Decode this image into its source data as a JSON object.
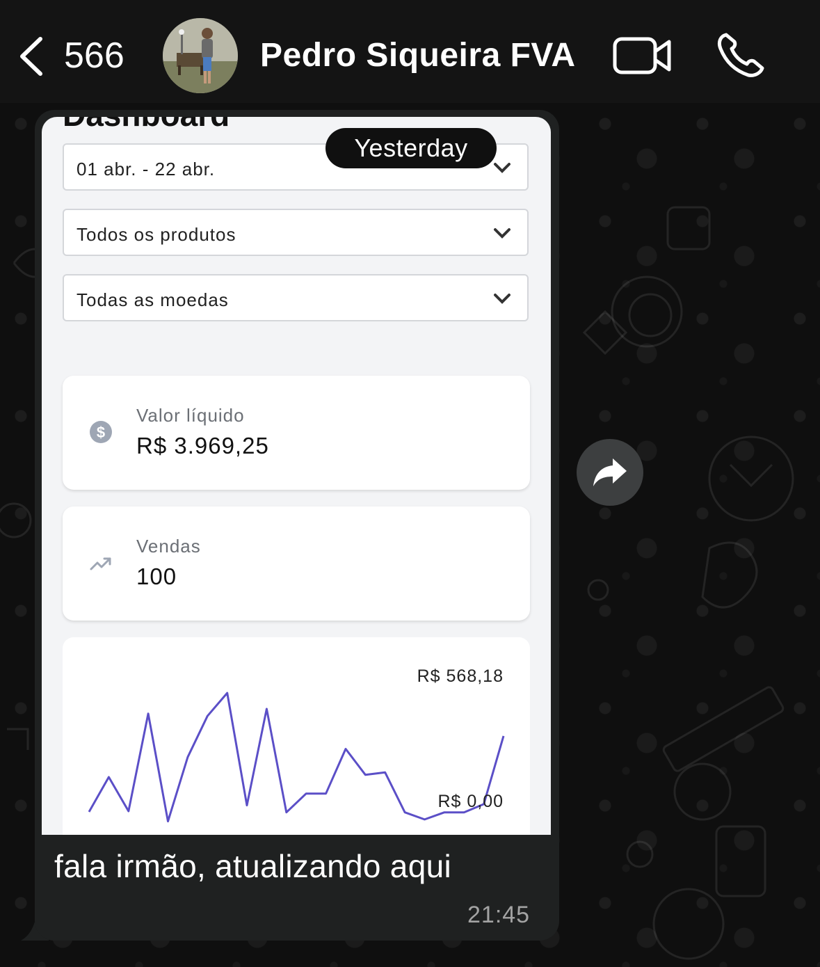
{
  "header": {
    "unread_count": "566",
    "contact_name": "Pedro Siqueira FVA"
  },
  "date_separator": "Yesterday",
  "screenshot": {
    "title": "Dashboard",
    "filters": [
      {
        "label": "01 abr. - 22 abr."
      },
      {
        "label": "Todos os produtos"
      },
      {
        "label": "Todas as moedas"
      }
    ],
    "cards": {
      "net_value": {
        "label": "Valor líquido",
        "value": "R$ 3.969,25",
        "icon": "dollar-circle-icon"
      },
      "sales": {
        "label": "Vendas",
        "value": "100",
        "icon": "trending-up-icon"
      }
    },
    "chart_data": {
      "type": "line",
      "title": "",
      "y_max_label": "R$ 568,18",
      "y_min_label": "R$ 0,00",
      "ylim": [
        0,
        568.18
      ],
      "color": "#5b4fc7",
      "values": [
        62,
        210,
        65,
        480,
        22,
        295,
        470,
        568,
        90,
        500,
        60,
        140,
        140,
        330,
        220,
        230,
        60,
        30,
        60,
        60,
        95,
        385
      ]
    }
  },
  "message": {
    "text": "fala irmão, atualizando aqui",
    "time": "21:45"
  }
}
